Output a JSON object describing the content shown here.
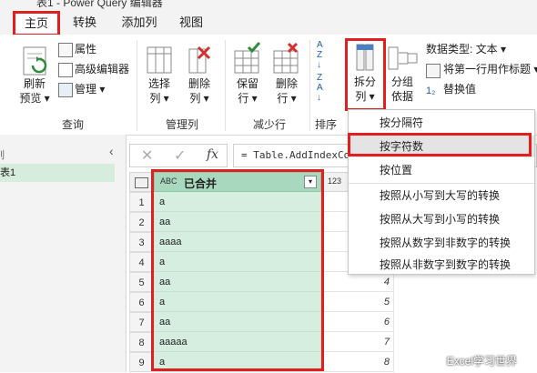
{
  "window": {
    "title": "表1 - Power Query 编辑器"
  },
  "tabs": [
    {
      "label": "主页",
      "active": true
    },
    {
      "label": "转换",
      "active": false
    },
    {
      "label": "添加列",
      "active": false
    },
    {
      "label": "视图",
      "active": false
    }
  ],
  "ribbon": {
    "groups": {
      "query": "查询",
      "manage_columns": "管理列",
      "reduce_rows": "减少行",
      "sort": "排序"
    },
    "refresh_preview": [
      "刷新",
      "预览 ▾"
    ],
    "properties": "属性",
    "advanced_editor": "高级编辑器",
    "manage": "管理 ▾",
    "choose_columns": [
      "选择",
      "列 ▾"
    ],
    "remove_columns": [
      "删除",
      "列 ▾"
    ],
    "keep_rows": [
      "保留",
      "行 ▾"
    ],
    "remove_rows": [
      "删除",
      "行 ▾"
    ],
    "split_column": [
      "拆分",
      "列 ▾"
    ],
    "group_by": [
      "分组",
      "依据"
    ],
    "data_type": "数据类型: 文本 ▾",
    "use_first_row": "将第一行用作标题 ▾",
    "replace_values": "替换值"
  },
  "split_menu": {
    "items": [
      {
        "label": "按分隔符",
        "highlighted": false
      },
      {
        "label": "按字符数",
        "highlighted": true
      },
      {
        "label": "按位置",
        "highlighted": false
      },
      {
        "label": "按照从小写到大写的转换",
        "highlighted": false
      },
      {
        "label": "按照从大写到小写的转换",
        "highlighted": false
      },
      {
        "label": "按照从数字到非数字的转换",
        "highlighted": false
      },
      {
        "label": "按照从非数字到数字的转换",
        "highlighted": false
      }
    ]
  },
  "queries_pane": {
    "items": [
      "表1"
    ]
  },
  "formula_bar": {
    "formula": "= Table.AddIndexCo",
    "fx_label": "fx"
  },
  "grid": {
    "column_header": {
      "type_icon": "ABC",
      "label": "已合并"
    },
    "second_header": {
      "type_icon": "123"
    },
    "row_numbers": [
      1,
      2,
      3,
      4,
      5,
      6,
      7,
      8,
      9
    ],
    "merged_values": [
      "a",
      "aa",
      "aaaa",
      "a",
      "aa",
      "a",
      "aa",
      "aaaaa",
      "a"
    ],
    "index_values": [
      "",
      "",
      "",
      "",
      "4",
      "5",
      "6",
      "7",
      "8"
    ]
  },
  "watermark": "Excel学习世界",
  "colors": {
    "highlight_red": "#e02020",
    "column_select": "#d5eee0",
    "header_select": "#a8d9bf"
  }
}
